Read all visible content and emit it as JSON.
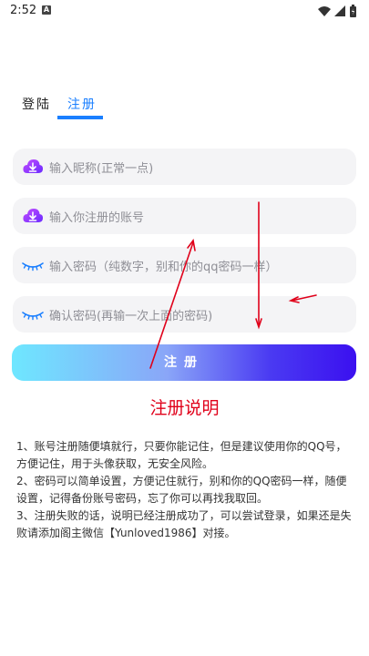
{
  "status_bar": {
    "time": "2:52",
    "notification_icon": "A",
    "icons": [
      "wifi-icon",
      "signal-icon",
      "battery-icon"
    ]
  },
  "tabs": {
    "login": "登陆",
    "register": "注册",
    "active": "register"
  },
  "form": {
    "nickname_placeholder": "输入昵称(正常一点)",
    "account_placeholder": "输入你注册的账号",
    "password_placeholder": "输入密码（纯数字，别和你的qq密码一样）",
    "confirm_placeholder": "确认密码(再输一次上面的密码)",
    "submit_label": "注册"
  },
  "notice": {
    "title": "注册说明",
    "lines": [
      "1、账号注册随便填就行，只要你能记住，但是建议使用你的QQ号，方便记住，用于头像获取，无安全风险。",
      "2、密码可以简单设置，方便记住就行，别和你的QQ密码一样，随便设置，记得备份账号密码，忘了你可以再找我取回。",
      "3、注册失败的话，说明已经注册成功了，可以尝试登录，如果还是失败请添加阁主微信【Yunloved1986】对接。"
    ]
  },
  "colors": {
    "accent": "#1a7fff",
    "notice_title": "#e0001a",
    "annotation": "#e0001a",
    "button_gradient": [
      "#6ee7ff",
      "#8aa6f8",
      "#4a3af2",
      "#3b10f0"
    ]
  }
}
